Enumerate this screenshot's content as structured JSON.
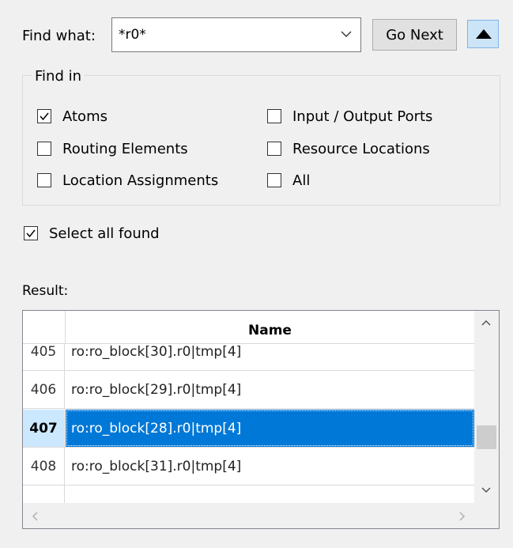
{
  "find": {
    "label": "Find what:",
    "value": "*r0*",
    "go_next_label": "Go Next"
  },
  "find_in": {
    "legend": "Find in",
    "options": [
      {
        "label": "Atoms",
        "checked": true
      },
      {
        "label": "Input / Output Ports",
        "checked": false
      },
      {
        "label": "Routing Elements",
        "checked": false
      },
      {
        "label": "Resource Locations",
        "checked": false
      },
      {
        "label": "Location Assignments",
        "checked": false
      },
      {
        "label": "All",
        "checked": false
      }
    ]
  },
  "select_all_found": {
    "label": "Select all found",
    "checked": true
  },
  "result": {
    "label": "Result:",
    "column_header": "Name",
    "rows": [
      {
        "num": "405",
        "name": "ro:ro_block[30].r0|tmp[4]",
        "selected": false
      },
      {
        "num": "406",
        "name": "ro:ro_block[29].r0|tmp[4]",
        "selected": false
      },
      {
        "num": "407",
        "name": "ro:ro_block[28].r0|tmp[4]",
        "selected": true
      },
      {
        "num": "408",
        "name": "ro:ro_block[31].r0|tmp[4]",
        "selected": false
      }
    ]
  },
  "colors": {
    "selection": "#0078d7",
    "selected_row_header": "#cce8ff",
    "collapse_button": "#cce4f7"
  }
}
